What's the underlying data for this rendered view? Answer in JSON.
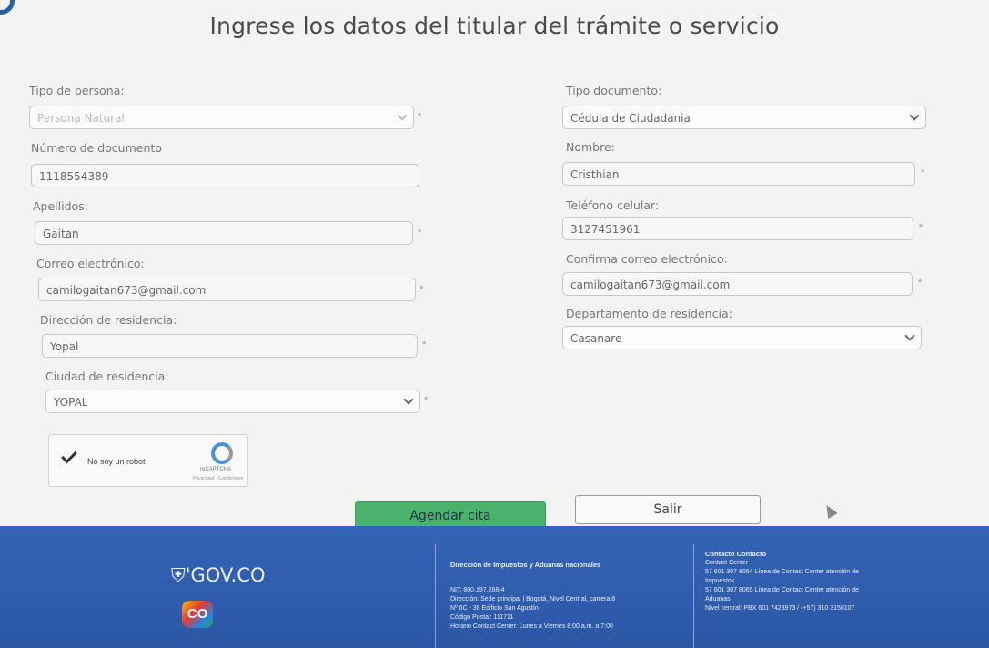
{
  "title": "Ingrese los datos del titular del trámite o servicio",
  "required_mark": "*",
  "form": {
    "tipo_persona": {
      "label": "Tipo de persona:",
      "value": "Persona Natural"
    },
    "tipo_documento": {
      "label": "Tipo documento:",
      "value": "Cédula de Ciudadania"
    },
    "numero_documento": {
      "label": "Número de documento",
      "value": "1118554389"
    },
    "nombre": {
      "label": "Nombre:",
      "value": "Cristhian"
    },
    "apellidos": {
      "label": "Apellidos:",
      "value": "Gaitan"
    },
    "telefono": {
      "label": "Teléfono celular:",
      "value": "3127451961"
    },
    "correo": {
      "label": "Correo electrónico:",
      "value": "camilogaitan673@gmail.com"
    },
    "confirma_correo": {
      "label": "Confirma correo electrónico:",
      "value": "camilogaitan673@gmail.com"
    },
    "direccion": {
      "label": "Dirección de residencia:",
      "value": "Yopal"
    },
    "departamento": {
      "label": "Departamento de residencia:",
      "value": "Casanare"
    },
    "ciudad": {
      "label": "Ciudad de residencia:",
      "value": "YOPAL"
    }
  },
  "captcha": {
    "label": "No soy un robot",
    "brand": "reCAPTCHA",
    "footer": "Privacidad - Condiciones"
  },
  "buttons": {
    "agendar": "Agendar cita",
    "salir": "Salir"
  },
  "footer": {
    "logo_text": "GOV.CO",
    "co_badge": "CO",
    "col1": {
      "title": "Dirección de Impuestos y Aduanas nacionales",
      "lines": [
        "NIT: 800.197.268-4",
        "Dirección: Sede principal | Bogotá, Nivel Central, carrera 8",
        "Nº 6C - 38 Edificio San Agustín",
        "Código Postal: 111711",
        "Horario Contact Center: Lunes a Viernes 8:00 a.m. a 7:00"
      ]
    },
    "col2": {
      "title": "Contacto Contacto",
      "lines": [
        "Contact Center",
        "57 601 307 8064 Línea de Contact Center atención de",
        "Impuestos",
        "57 601 307 8065 Línea de Contact Center atención de",
        "Aduanas",
        "Nivel central: PBX 601 7428973 / (+57) 310 3158107"
      ]
    }
  }
}
